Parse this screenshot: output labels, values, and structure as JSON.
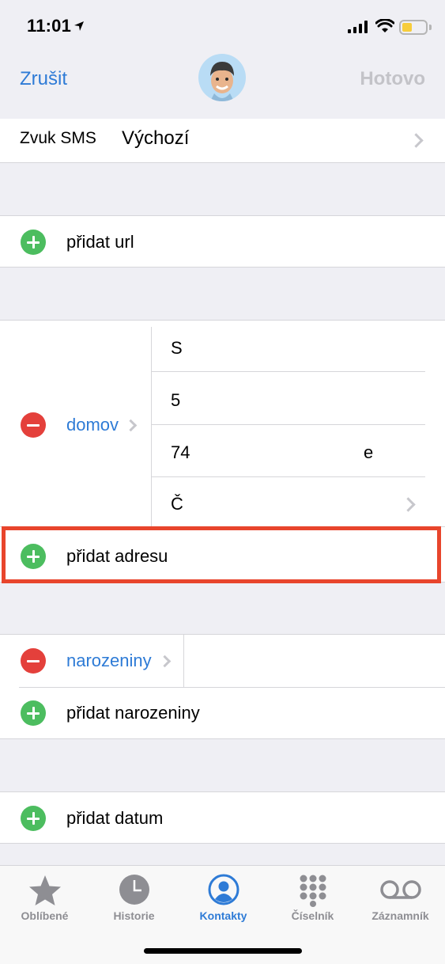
{
  "status": {
    "time": "11:01"
  },
  "nav": {
    "cancel": "Zrušit",
    "done": "Hotovo"
  },
  "sms": {
    "label": "Zvuk SMS",
    "value": "Výchozí"
  },
  "url": {
    "add_label": "přidat url"
  },
  "address": {
    "type_label": "domov",
    "lines": [
      "S",
      "5",
      "74",
      "e",
      "Č"
    ],
    "add_label": "přidat adresu"
  },
  "birthday": {
    "type_label": "narozeniny",
    "add_label": "přidat narozeniny"
  },
  "date": {
    "add_label": "přidat datum"
  },
  "tabs": [
    {
      "label": "Oblíbené",
      "icon": "star-icon"
    },
    {
      "label": "Historie",
      "icon": "clock-icon"
    },
    {
      "label": "Kontakty",
      "icon": "person-icon",
      "active": true
    },
    {
      "label": "Číselník",
      "icon": "keypad-icon"
    },
    {
      "label": "Záznamník",
      "icon": "voicemail-icon"
    }
  ],
  "colors": {
    "accent": "#2e7bd6",
    "add": "#4cbd5f",
    "remove": "#e4403b",
    "highlight": "#e8452c"
  }
}
